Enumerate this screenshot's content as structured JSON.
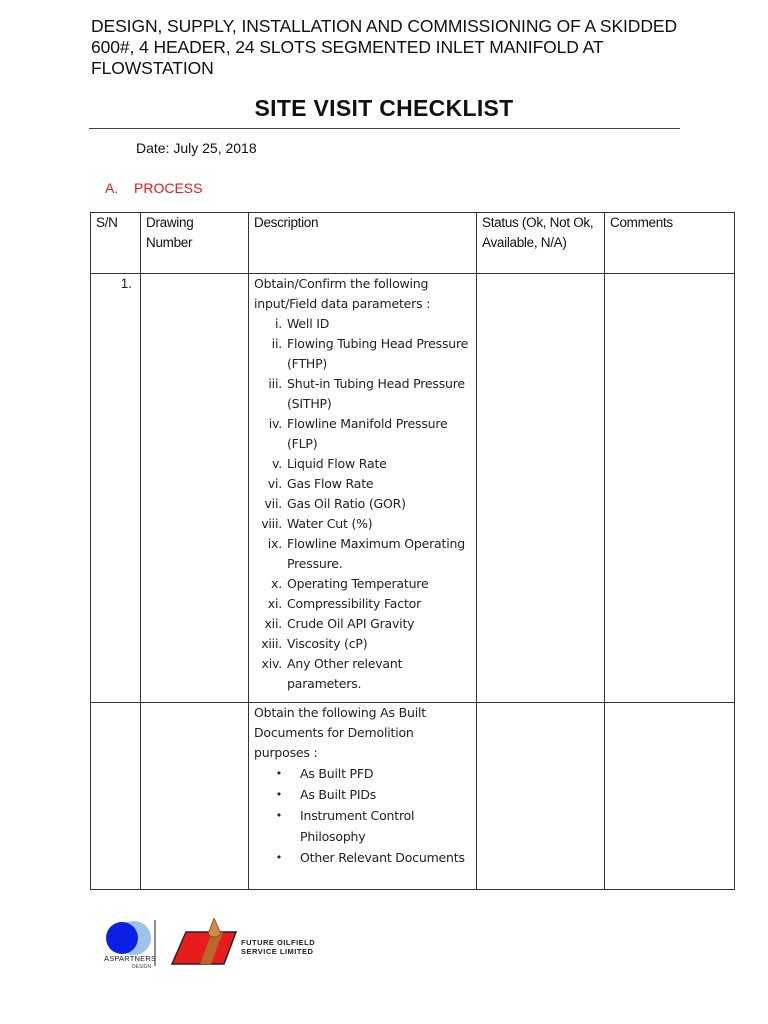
{
  "document": {
    "project_title": "DESIGN, SUPPLY, INSTALLATION AND COMMISSIONING OF A SKIDDED 600#, 4 HEADER, 24 SLOTS SEGMENTED INLET MANIFOLD AT FLOWSTATION",
    "page_title": "SITE VISIT CHECKLIST",
    "date": "Date: July 25, 2018",
    "section": {
      "number": "A.",
      "label": "PROCESS",
      "color": "#e41b1b"
    }
  },
  "table": {
    "headers": [
      "S/N",
      "Drawing Number",
      "Description",
      "Status (Ok, Not Ok, Available, N/A)",
      "Comments"
    ],
    "rows": [
      {
        "sn": "1.",
        "drawing_number": "",
        "intro": "Obtain/Confirm the following input/Field data parameters :",
        "items": [
          {
            "n": "i.",
            "t": "Well ID"
          },
          {
            "n": "ii.",
            "t": "Flowing Tubing Head Pressure (FTHP)"
          },
          {
            "n": "iii.",
            "t": "Shut-in Tubing Head Pressure (SITHP)"
          },
          {
            "n": "iv.",
            "t": "Flowline Manifold Pressure (FLP)"
          },
          {
            "n": "v.",
            "t": "Liquid Flow Rate"
          },
          {
            "n": "vi.",
            "t": "Gas Flow Rate"
          },
          {
            "n": "vii.",
            "t": "Gas Oil Ratio (GOR)"
          },
          {
            "n": "viii.",
            "t": "Water Cut (%)"
          },
          {
            "n": "ix.",
            "t": "Flowline Maximum Operating Pressure."
          },
          {
            "n": "x.",
            "t": "Operating Temperature"
          },
          {
            "n": "xi.",
            "t": "Compressibility Factor"
          },
          {
            "n": "xii.",
            "t": "Crude Oil API Gravity"
          },
          {
            "n": "xiii.",
            "t": "Viscosity (cP)"
          },
          {
            "n": "xiv.",
            "t": "Any Other relevant parameters."
          }
        ],
        "status": "",
        "comments": ""
      },
      {
        "sn": "",
        "drawing_number": "",
        "intro": "Obtain the following As Built Documents for Demolition purposes :",
        "bullet": "•",
        "items": [
          {
            "t": "As Built PFD"
          },
          {
            "t": "As Built PIDs"
          },
          {
            "t": "Instrument Control Philosophy"
          },
          {
            "t": "Other Relevant Documents"
          }
        ],
        "status": "",
        "comments": ""
      }
    ]
  },
  "logos": {
    "left": {
      "name": "ASPARTNERS",
      "sub": "DESIGN"
    },
    "right": {
      "line1": "FUTURE OILFIELD",
      "line2": "SERVICE LIMITED"
    }
  }
}
